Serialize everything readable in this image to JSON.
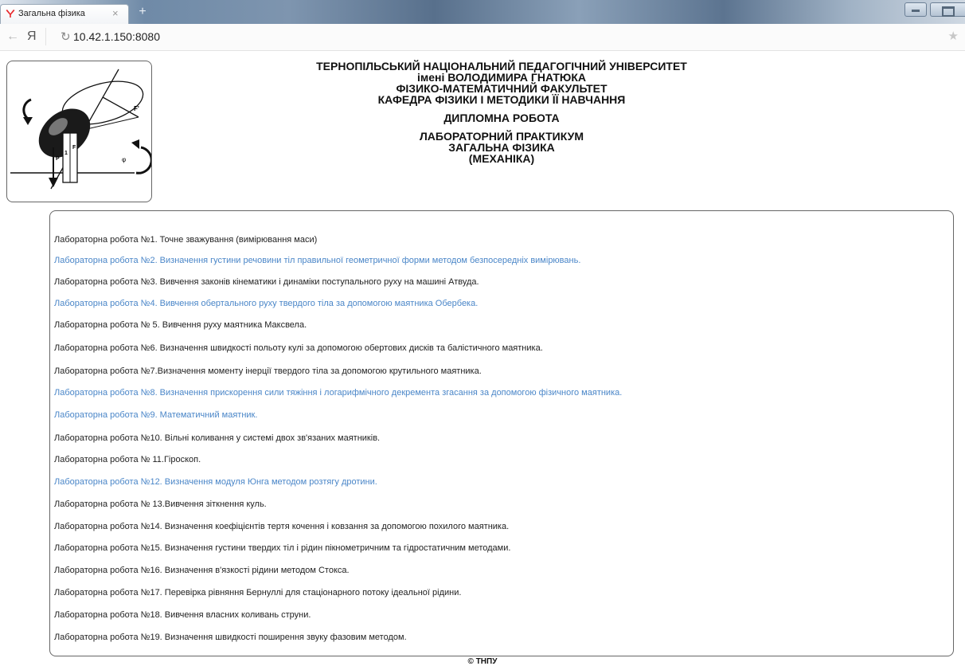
{
  "browser": {
    "tab_title": "Загальна фізика",
    "tab_close": "×",
    "new_tab": "+",
    "back_glyph": "←",
    "ya_glyph": "Я",
    "reload_glyph": "↻",
    "url": "10.42.1.150:8080",
    "star_glyph": "★"
  },
  "header": {
    "lines": [
      "ТЕРНОПІЛЬСЬКИЙ НАЦІОНАЛЬНИЙ ПЕДАГОГІЧНИЙ УНІВЕРСИТЕТ",
      "імені ВОЛОДИМИРА ГНАТЮКА",
      "ФІЗИКО-МАТЕМАТИЧНИЙ ФАКУЛЬТЕТ",
      "КАФЕДРА ФІЗИКИ І МЕТОДИКИ ЇЇ НАВЧАННЯ",
      "ДИПЛОМНА РОБОТА",
      "ЛАБОРАТОРНИЙ ПРАКТИКУМ",
      "ЗАГАЛЬНА ФІЗИКА",
      "(МЕХАНІКА)"
    ]
  },
  "logo": {
    "labels": [
      "P",
      "F",
      "1",
      "F'",
      "φ"
    ]
  },
  "labs": [
    {
      "text": "Лабораторна робота №1. Точне зважування (вимірювання маси)",
      "link": false
    },
    {
      "text": "Лабораторна робота №2. Визначення густини речовини тіл правильної геометричної форми методом безпосередніх вимірювань.",
      "link": true
    },
    {
      "text": "Лабораторна робота №3. Вивчення законів кінематики і динаміки поступального руху на машині Атвуда.",
      "link": false
    },
    {
      "text": "Лабораторна робота №4. Вивчення обертального руху твердого тіла за допомогою маятника Обербека.",
      "link": true
    },
    {
      "text": "Лабораторна робота № 5. Вивчення руху маятника Максвела.",
      "link": false
    },
    {
      "text": "Лабораторна робота №6. Визначення швидкості польоту кулі за допомогою обертових дисків та балістичного маятника.",
      "link": false
    },
    {
      "text": "Лабораторна робота №7.Визначення моменту інерції твердого тіла за допомогою крутильного маятника.",
      "link": false
    },
    {
      "text": "Лабораторна робота №8. Визначення прискорення сили тяжіння і логарифмічного декремента згасання за допомогою фізичного маятника.",
      "link": true
    },
    {
      "text": "Лабораторна робота №9. Математичний маятник.",
      "link": true
    },
    {
      "text": "Лабораторна робота №10. Вільні коливання у системі двох зв'язаних маятників.",
      "link": false
    },
    {
      "text": "Лабораторна робота № 11.Гіроскоп.",
      "link": false
    },
    {
      "text": "Лабораторна робота №12. Визначення модуля Юнга методом розтягу дротини.",
      "link": true
    },
    {
      "text": "Лабораторна робота № 13.Вивчення зіткнення куль.",
      "link": false
    },
    {
      "text": "Лабораторна робота №14. Визначення коефіцієнтів тертя кочення і ковзання за допомогою похилого маятника.",
      "link": false
    },
    {
      "text": "Лабораторна робота №15. Визначення густини твердих тіл і рідин пікнометричним та гідростатичним методами.",
      "link": false
    },
    {
      "text": "Лабораторна робота №16. Визначення в'язкості рідини методом Стокса.",
      "link": false
    },
    {
      "text": "Лабораторна робота №17. Перевірка рівняння Бернуллі для стаціонарного потоку ідеальної рідини.",
      "link": false
    },
    {
      "text": "Лабораторна робота №18. Вивчення власних коливань струни.",
      "link": false
    },
    {
      "text": "Лабораторна робота №19. Визначення швидкості поширення звуку фазовим методом.",
      "link": false
    }
  ],
  "footer": "© ТНПУ",
  "colors": {
    "link": "#4a86c8",
    "text": "#222222",
    "yandex_red": "#e8272c"
  }
}
